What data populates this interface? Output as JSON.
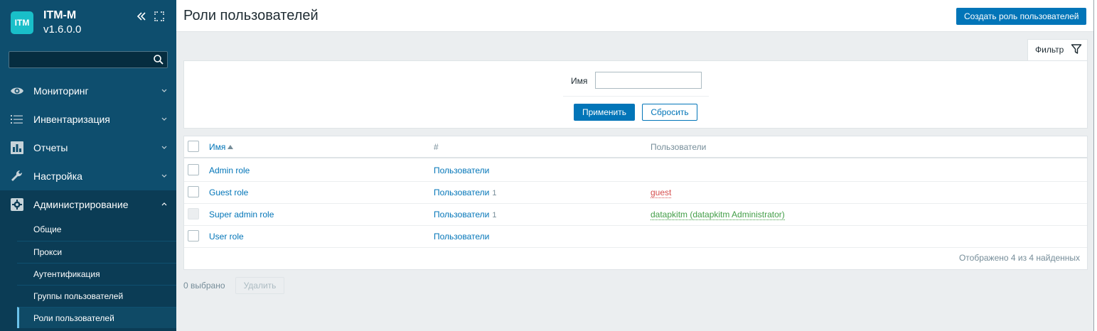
{
  "app": {
    "logo_text": "ITM",
    "name": "ITM-M",
    "version": "v1.6.0.0"
  },
  "sidebar": {
    "search_placeholder": "",
    "menu": [
      {
        "label": "Мониторинг",
        "icon": "eye-icon"
      },
      {
        "label": "Инвентаризация",
        "icon": "list-icon"
      },
      {
        "label": "Отчеты",
        "icon": "bar-chart-icon"
      },
      {
        "label": "Настройка",
        "icon": "wrench-icon"
      },
      {
        "label": "Администрирование",
        "icon": "gear-icon",
        "expanded": true
      }
    ],
    "submenu": [
      {
        "label": "Общие"
      },
      {
        "label": "Прокси"
      },
      {
        "label": "Аутентификация"
      },
      {
        "label": "Группы пользователей"
      },
      {
        "label": "Роли пользователей",
        "selected": true
      }
    ]
  },
  "header": {
    "title": "Роли пользователей",
    "create_button": "Создать роль пользователей"
  },
  "filter": {
    "tab_label": "Фильтр",
    "name_label": "Имя",
    "name_value": "",
    "apply_label": "Применить",
    "reset_label": "Сбросить"
  },
  "table": {
    "columns": {
      "name": "Имя",
      "hash": "#",
      "users": "Пользователи"
    },
    "rows": [
      {
        "name": "Admin role",
        "users_link": "Пользователи",
        "count": "",
        "members": "",
        "member_color": ""
      },
      {
        "name": "Guest role",
        "users_link": "Пользователи",
        "count": "1",
        "members": "guest",
        "member_color": "red"
      },
      {
        "name": "Super admin role",
        "users_link": "Пользователи",
        "count": "1",
        "members": "datapkitm (datapkitm Administrator)",
        "member_color": "green",
        "disabled": true
      },
      {
        "name": "User role",
        "users_link": "Пользователи",
        "count": "",
        "members": "",
        "member_color": ""
      }
    ],
    "footer": "Отображено 4 из 4 найденных"
  },
  "actions": {
    "selected_count": "0 выбрано",
    "delete_label": "Удалить"
  }
}
